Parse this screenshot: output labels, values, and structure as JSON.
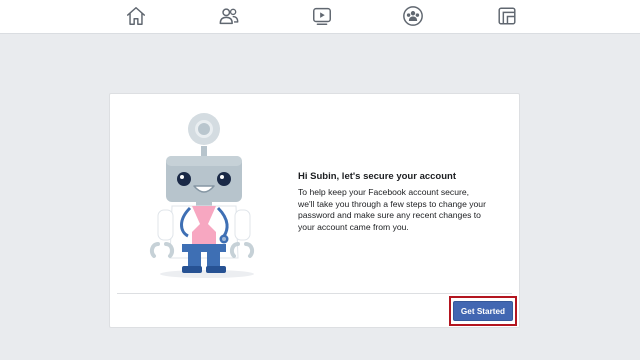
{
  "nav": {
    "items": [
      {
        "icon": "home-icon"
      },
      {
        "icon": "friends-icon"
      },
      {
        "icon": "watch-icon"
      },
      {
        "icon": "groups-icon"
      },
      {
        "icon": "pages-icon"
      }
    ]
  },
  "card": {
    "title": "Hi Subin, let's secure your account",
    "lines": [
      "To help keep your Facebook account secure,",
      "we'll take you through a few steps to change your",
      "password and make sure any recent changes to",
      "your account came from you."
    ],
    "button_label": "Get Started"
  },
  "colors": {
    "button_blue": "#4267b2",
    "highlight_red": "#b3151f",
    "page_background": "#e9ebee"
  }
}
